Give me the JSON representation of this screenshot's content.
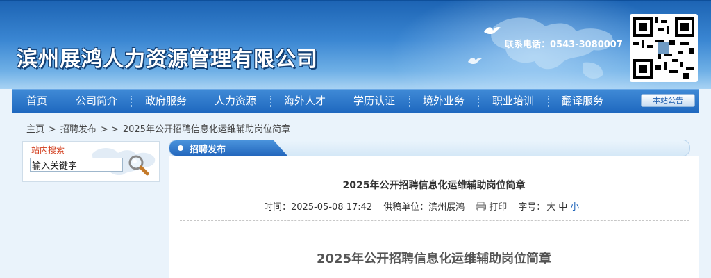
{
  "header": {
    "site_title": "滨州展鸿人力资源管理有限公司",
    "contact": "联系电话：0543-3080007",
    "qr_code_icon": "qr-code",
    "colors": {
      "banner_top": "#1c63b3",
      "banner_bottom": "#a8d2f3"
    }
  },
  "nav": {
    "items": [
      "首页",
      "公司简介",
      "政府服务",
      "人力资源",
      "海外人才",
      "学历认证",
      "境外业务",
      "职业培训",
      "翻译服务"
    ],
    "notice_label": "本站公告",
    "color": "#1f68bf"
  },
  "breadcrumb": {
    "home": "主页",
    "sep1": ">",
    "section": "招聘发布",
    "sep2": "> >",
    "current": "2025年公开招聘信息化运维辅助岗位简章"
  },
  "search": {
    "label": "站内搜索",
    "value": "输入关键字",
    "icon": "magnifier-icon"
  },
  "content": {
    "tab_label": "招聘发布",
    "article_title": "2025年公开招聘信息化运维辅助岗位简章",
    "meta": {
      "time_label": "时间：",
      "time_value": "2025-05-08 17:42",
      "source_label": "供稿单位：",
      "source_value": "滨州展鸿",
      "print_label": "打印",
      "font_label": "字号：",
      "font_sizes": [
        "大",
        "中",
        "小"
      ]
    },
    "body_heading": "2025年公开招聘信息化运维辅助岗位简章"
  }
}
